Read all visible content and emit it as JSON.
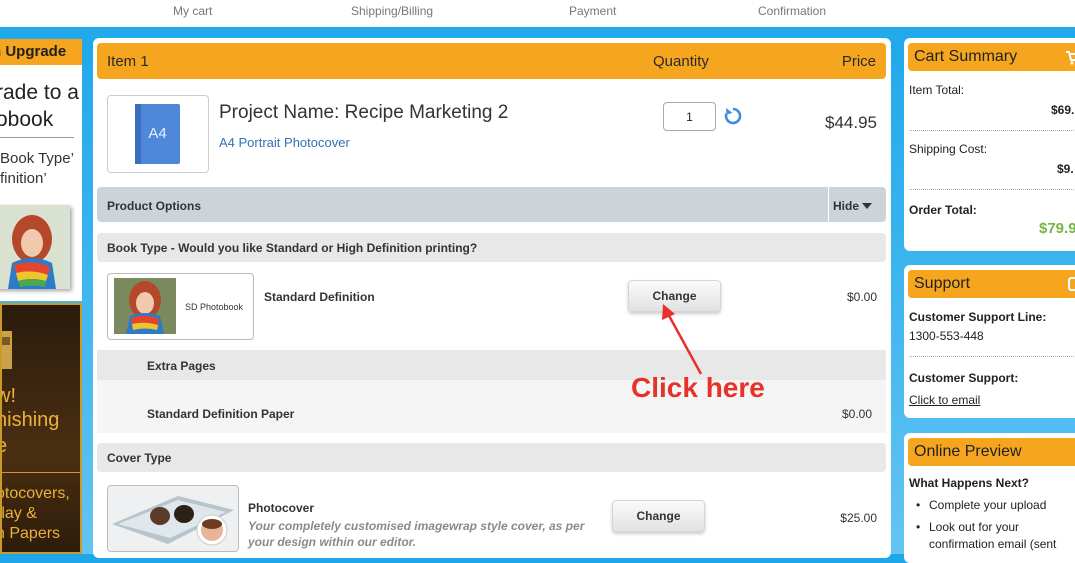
{
  "steps": [
    "My cart",
    "Shipping/Billing",
    "Payment",
    "Confirmation"
  ],
  "promo": {
    "upgrade_header": "n Upgrade",
    "line1": "rade to a",
    "line2": "obook",
    "line3": "Book Type’",
    "line4": "finition’",
    "bottom1": "w!",
    "bottom2": "nishing",
    "bottom3": "e",
    "bottom4": "otocovers,",
    "bottom5": "rlay &",
    "bottom6": "n Papers"
  },
  "cart": {
    "item_header": "Item 1",
    "quantity_header": "Quantity",
    "price_header": "Price",
    "thumb_label": "A4",
    "project_name": "Project Name: Recipe Marketing 2",
    "project_sub": "A4 Portrait Photocover",
    "quantity": "1",
    "price": "$44.95"
  },
  "options": {
    "title": "Product Options",
    "hide_label": "Hide",
    "book_type_question": "Book Type - Would you like Standard or High Definition printing?",
    "sd_thumb_label": "SD Photobook",
    "sd_name": "Standard Definition",
    "change_label": "Change",
    "sd_price": "$0.00",
    "extra_pages": "Extra Pages",
    "paper_name": "Standard Definition Paper",
    "paper_price": "$0.00",
    "cover_type": "Cover Type",
    "cover_name": "Photocover",
    "cover_desc": "Your completely customised imagewrap style cover, as per your design within our editor.",
    "cover_price": "$25.00"
  },
  "annotation": {
    "text": "Click here",
    "color": "#e8312b"
  },
  "summary": {
    "title": "Cart Summary",
    "item_total_label": "Item Total:",
    "item_total": "$69.",
    "shipping_label": "Shipping Cost:",
    "shipping": "$9.",
    "order_total_label": "Order Total:",
    "order_total": "$79.9"
  },
  "support": {
    "title": "Support",
    "line_label": "Customer Customer Support Line:",
    "line_label_short": "Customer Support Line:",
    "phone": "1300-553-448",
    "cs_label": "Customer Support:",
    "email_link": "Click to email"
  },
  "preview": {
    "title": "Online Preview",
    "next_label": "What Happens Next?",
    "bullet1": "Complete your upload",
    "bullet2a": "Look out for your",
    "bullet2b": "confirmation email (sent"
  },
  "colors": {
    "accent": "#f6a61e",
    "background": "#1da7ea",
    "link": "#3272b4",
    "green": "#7ab542"
  }
}
